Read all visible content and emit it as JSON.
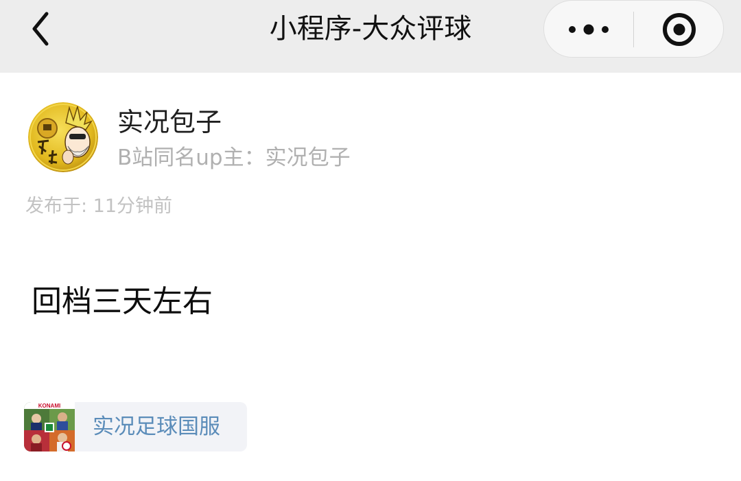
{
  "nav": {
    "title": "小程序-大众评球",
    "back_icon": "chevron-left-icon",
    "more_icon": "more-dots-icon",
    "close_icon": "target-close-icon"
  },
  "post": {
    "author": {
      "name": "实况包子",
      "bio": "B站同名up主：实况包子",
      "avatar_icon": "avatar-cartoon"
    },
    "time": "发布于: 11分钟前",
    "content": "回档三天左右",
    "topic": {
      "label": "实况足球国服",
      "thumb_brand": "KONAMI",
      "thumb_icon": "game-cover-thumbnail"
    }
  },
  "colors": {
    "nav_bg": "#ededed",
    "topic_text": "#5b8cb9",
    "topic_bg": "#f2f3f7",
    "muted_text": "#b0b0b0"
  }
}
